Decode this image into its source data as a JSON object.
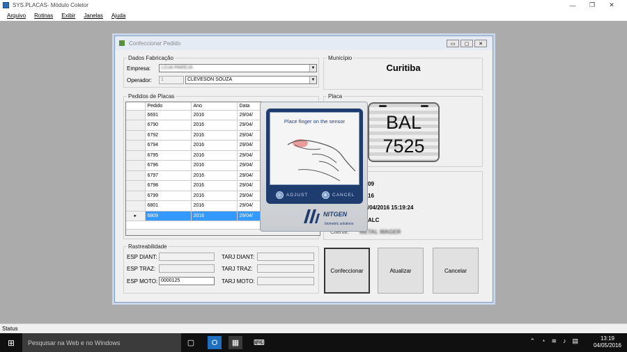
{
  "window": {
    "title": "SYS.PLACAS- Módulo Coletor",
    "minimize": "—",
    "maximize": "❐",
    "close": "✕"
  },
  "menu": [
    "Arquivo",
    "Rotinas",
    "Exibir",
    "Janelas",
    "Ajuda"
  ],
  "dialog": {
    "title": "Confeccionar Pedido",
    "fabricacao": {
      "legend": "Dados Fabricação",
      "empresa_label": "Empresa:",
      "empresa_value": "LOJA PAREJA",
      "operador_label": "Operador:",
      "operador_id": "1",
      "operador_name": "CLEVESON SOUZA"
    },
    "municipio": {
      "legend": "Município",
      "value": "Curitiba"
    },
    "placa": {
      "legend": "Placa",
      "letters": "BAL",
      "numbers": "7525"
    },
    "pedidos": {
      "legend": "Pedidos de Placas",
      "columns": [
        "Pedido",
        "Ano",
        "Data"
      ],
      "rows": [
        [
          "6691",
          "2016",
          "29/04/"
        ],
        [
          "6790",
          "2016",
          "29/04/"
        ],
        [
          "6792",
          "2016",
          "29/04/"
        ],
        [
          "6794",
          "2016",
          "29/04/"
        ],
        [
          "6795",
          "2016",
          "29/04/"
        ],
        [
          "6796",
          "2016",
          "29/04/"
        ],
        [
          "6797",
          "2016",
          "29/04/"
        ],
        [
          "6798",
          "2016",
          "29/04/"
        ],
        [
          "6799",
          "2016",
          "29/04/"
        ],
        [
          "6801",
          "2016",
          "29/04/"
        ],
        [
          "6809",
          "2016",
          "29/04/"
        ]
      ],
      "selected_index": 10
    },
    "detalhes": {
      "line1": "09",
      "line2": "16",
      "line3": "/04/2016 15:19:24",
      "line4": "ALC",
      "cliente_label": "Cliente:",
      "cliente_value": "METAL WAGER"
    },
    "rastreabilidade": {
      "legend": "Rastreabilidade",
      "esp_diant_label": "ESP DIANT:",
      "esp_traz_label": "ESP TRAZ:",
      "esp_moto_label": "ESP MOTO:",
      "esp_moto_value": "0000125",
      "tarj_diant_label": "TARJ DIANT:",
      "tarj_traz_label": "TARJ TRAZ:",
      "tarj_moto_label": "TARJ MOTO:"
    },
    "buttons": {
      "confeccionar": "Confeccionar",
      "atualizar": "Atualizar",
      "cancelar": "Cancelar"
    }
  },
  "biometric": {
    "prompt": "Place finger on the sensor",
    "adjust": "ADJUST",
    "cancel": "CANCEL",
    "brand": "NITGEN",
    "brand_sub": "biometric solutions"
  },
  "status": "Status",
  "taskbar": {
    "search_placeholder": "Pesquisar na Web e no Windows",
    "time": "13:19",
    "date": "04/05/2016"
  }
}
